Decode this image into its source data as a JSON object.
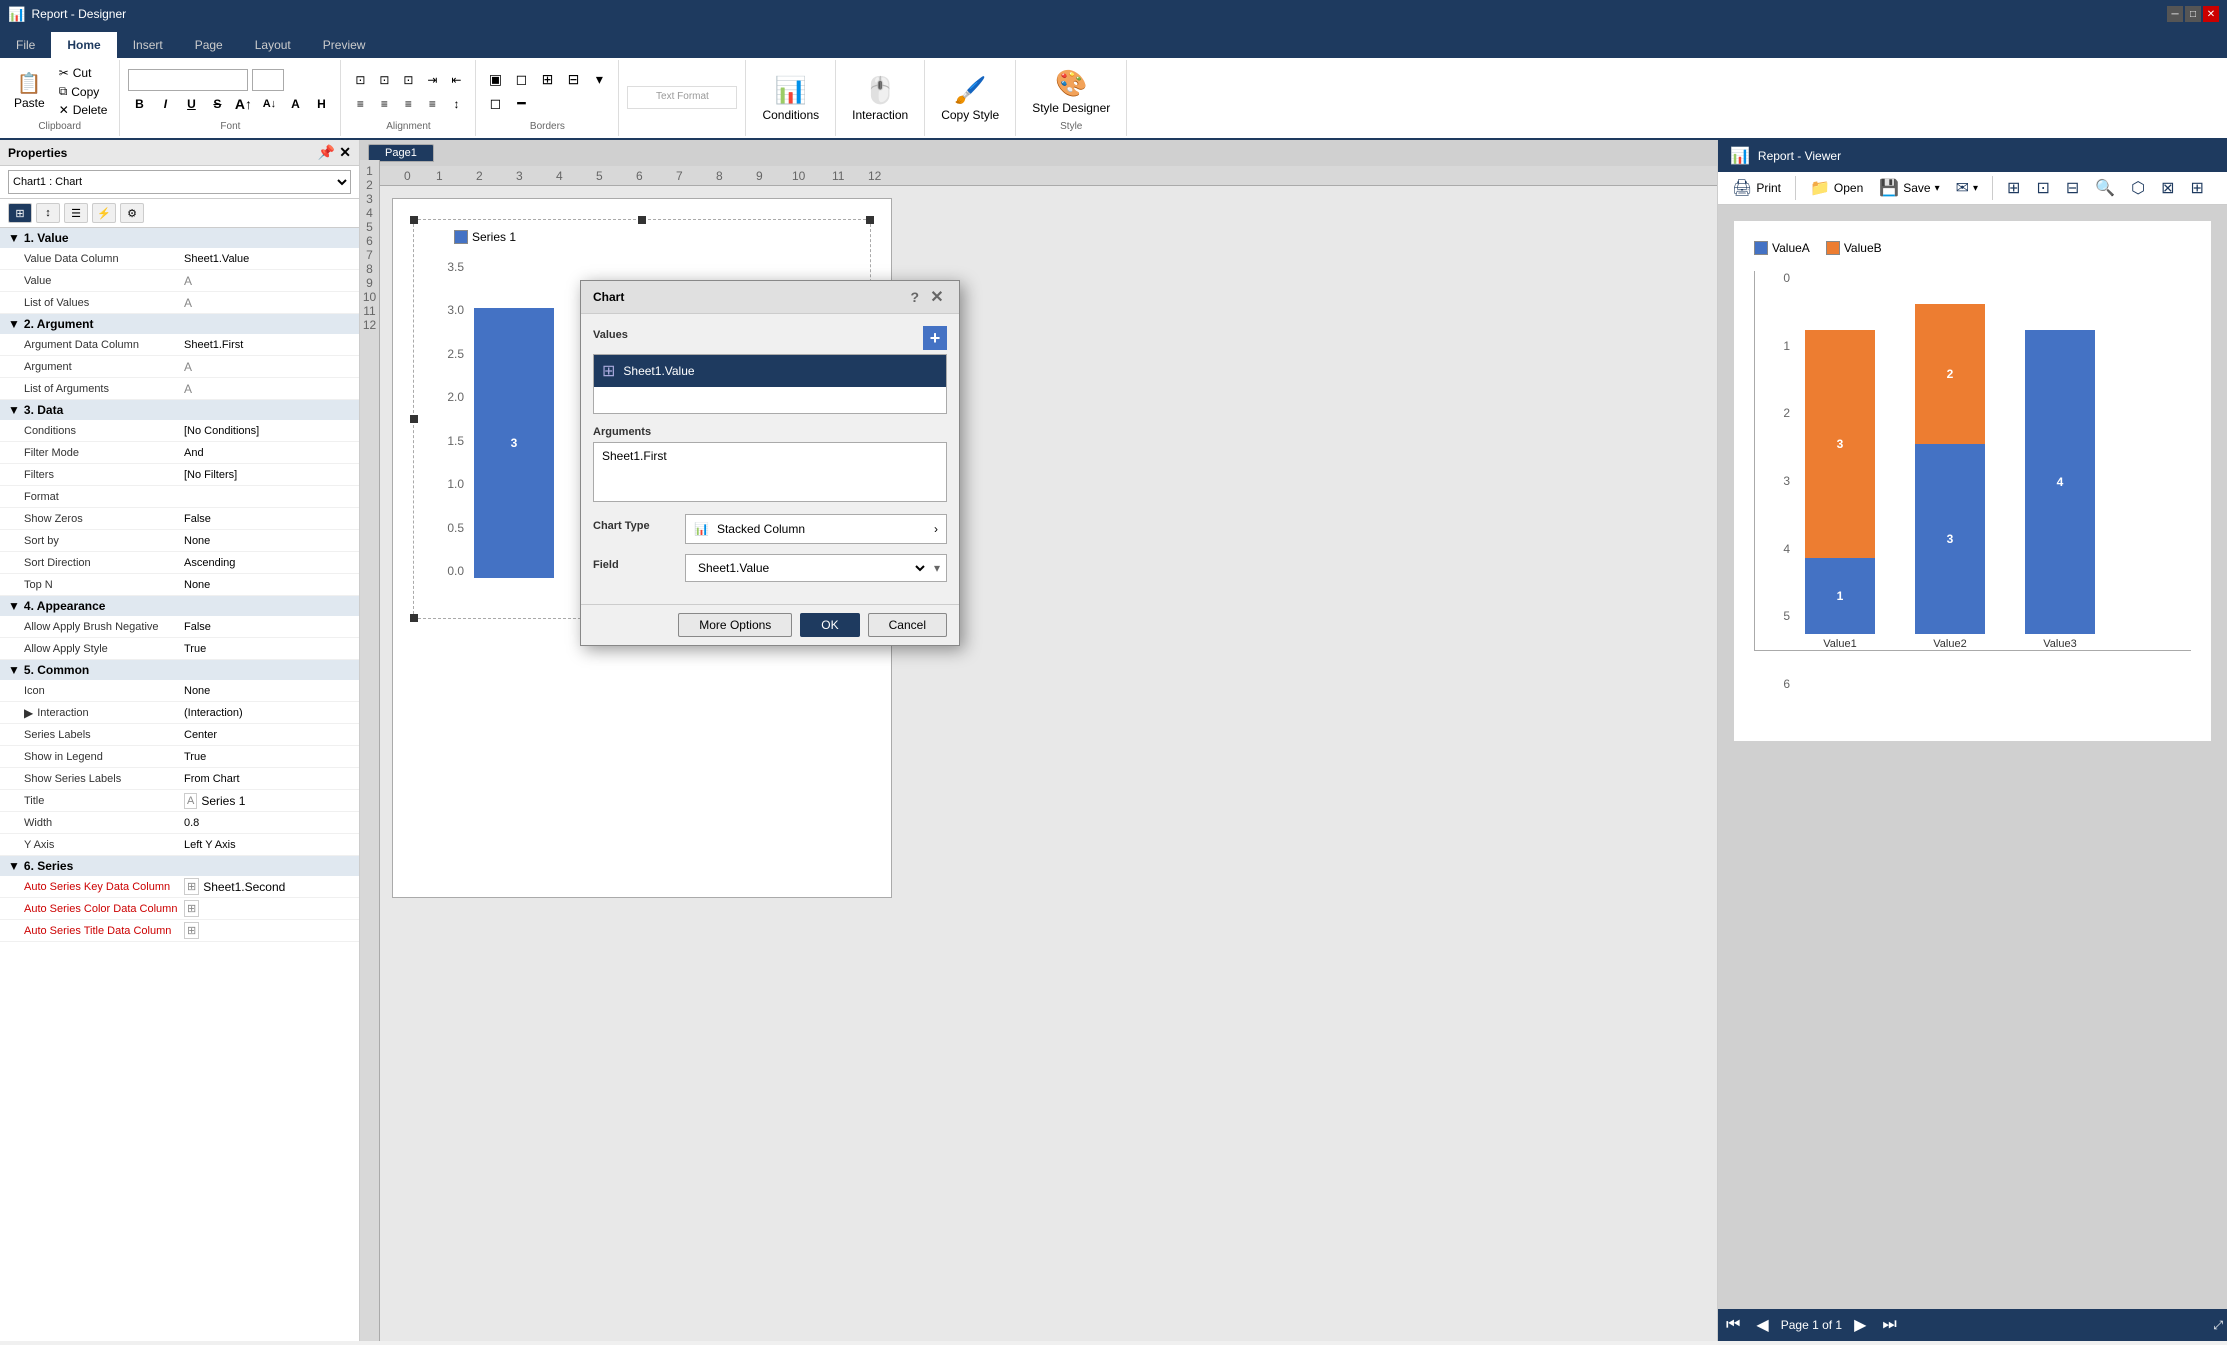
{
  "app": {
    "title": "Report - Designer",
    "viewer_title": "Report - Viewer"
  },
  "ribbon": {
    "tabs": [
      "File",
      "Home",
      "Insert",
      "Page",
      "Layout",
      "Preview"
    ],
    "active_tab": "Home",
    "groups": {
      "clipboard": {
        "label": "Clipboard",
        "buttons": [
          "Cut",
          "Copy",
          "Delete"
        ]
      },
      "font": {
        "label": "Font",
        "font_name": "",
        "font_size": "",
        "bold": "B",
        "italic": "I",
        "underline": "U"
      },
      "alignment": {
        "label": "Alignment"
      },
      "borders": {
        "label": "Borders"
      },
      "text_format": {
        "label": "Text Format"
      },
      "conditions_label": "Conditions",
      "interaction_label": "Interaction",
      "copy_style_label": "Copy Style",
      "style_designer_label": "Style Designer"
    }
  },
  "properties": {
    "panel_title": "Properties",
    "chart_selector": "Chart1 : Chart",
    "sections": {
      "value": {
        "title": "1. Value",
        "rows": [
          {
            "label": "Value Data Column",
            "value": "Sheet1.Value",
            "red": false
          },
          {
            "label": "Value",
            "value": "",
            "red": false
          },
          {
            "label": "List of Values",
            "value": "",
            "red": false
          }
        ]
      },
      "argument": {
        "title": "2. Argument",
        "rows": [
          {
            "label": "Argument Data Column",
            "value": "Sheet1.First",
            "red": false
          },
          {
            "label": "Argument",
            "value": "",
            "red": false
          },
          {
            "label": "List of Arguments",
            "value": "",
            "red": false
          }
        ]
      },
      "data": {
        "title": "3. Data",
        "rows": [
          {
            "label": "Conditions",
            "value": "[No Conditions]",
            "red": false
          },
          {
            "label": "Filter Mode",
            "value": "And",
            "red": false
          },
          {
            "label": "Filters",
            "value": "[No Filters]",
            "red": false
          },
          {
            "label": "Format",
            "value": "",
            "red": false
          },
          {
            "label": "Show Zeros",
            "value": "False",
            "red": false
          },
          {
            "label": "Sort by",
            "value": "None",
            "red": false
          },
          {
            "label": "Sort Direction",
            "value": "Ascending",
            "red": false
          },
          {
            "label": "Top N",
            "value": "None",
            "red": false
          }
        ]
      },
      "appearance": {
        "title": "4. Appearance",
        "rows": [
          {
            "label": "Allow Apply Brush Negative",
            "value": "False",
            "red": false
          },
          {
            "label": "Allow Apply Style",
            "value": "True",
            "red": false
          }
        ]
      },
      "common": {
        "title": "5. Common",
        "rows": [
          {
            "label": "Icon",
            "value": "None",
            "red": false
          },
          {
            "label": "Interaction",
            "value": "(Interaction)",
            "red": false
          },
          {
            "label": "Series Labels",
            "value": "Center",
            "red": false
          },
          {
            "label": "Show in Legend",
            "value": "True",
            "red": false
          },
          {
            "label": "Show Series Labels",
            "value": "From Chart",
            "red": false
          },
          {
            "label": "Title",
            "value": "Series 1",
            "red": false
          },
          {
            "label": "Width",
            "value": "0.8",
            "red": false
          },
          {
            "label": "Y Axis",
            "value": "Left Y Axis",
            "red": false
          }
        ]
      },
      "series": {
        "title": "6. Series",
        "rows": [
          {
            "label": "Auto Series Key Data Column",
            "value": "Sheet1.Second",
            "red": true
          },
          {
            "label": "Auto Series Color Data Column",
            "value": "",
            "red": true
          },
          {
            "label": "Auto Series Title Data Column",
            "value": "",
            "red": true
          }
        ]
      }
    }
  },
  "page": {
    "tabs": [
      "Page1"
    ],
    "active_tab": "Page1"
  },
  "chart": {
    "legend_items": [
      "Series 1"
    ],
    "y_axis_labels": [
      "3.5",
      "3.0",
      "2.5",
      "2.0",
      "1.5",
      "1.0",
      "0.5",
      "0.0"
    ],
    "bars": [
      {
        "height_pct": 85,
        "label": "3"
      },
      {
        "height_pct": 55,
        "label": "2"
      }
    ]
  },
  "viewer": {
    "toolbar_buttons": [
      "Print",
      "Open",
      "Save",
      "Email"
    ],
    "legend_items": [
      {
        "color": "#4472c4",
        "label": "ValueA"
      },
      {
        "color": "#ed7d31",
        "label": "ValueB"
      }
    ],
    "y_axis_labels": [
      "6",
      "5",
      "4",
      "3",
      "2",
      "1",
      "0"
    ],
    "bars": [
      {
        "label": "Value1",
        "segments": [
          {
            "color": "#4472c4",
            "height_pct": 20,
            "label": "1"
          },
          {
            "color": "#ed7d31",
            "height_pct": 60,
            "label": "3"
          }
        ]
      },
      {
        "label": "Value2",
        "segments": [
          {
            "color": "#4472c4",
            "height_pct": 50,
            "label": "3"
          },
          {
            "color": "#ed7d31",
            "height_pct": 37,
            "label": "2"
          }
        ]
      },
      {
        "label": "Value3",
        "segments": [
          {
            "color": "#4472c4",
            "height_pct": 67,
            "label": "4"
          },
          {
            "color": "#ed7d31",
            "height_pct": 0,
            "label": ""
          }
        ]
      }
    ],
    "page_info": "Page 1 of 1"
  },
  "modal": {
    "title": "Chart",
    "values_label": "Values",
    "values_item": "Sheet1.Value",
    "arguments_label": "Arguments",
    "arguments_item": "Sheet1.First",
    "chart_type_label": "Chart Type",
    "chart_type_value": "Stacked Column",
    "field_label": "Field",
    "field_value": "Sheet1.Value",
    "more_options_label": "More Options",
    "ok_label": "OK",
    "cancel_label": "Cancel"
  }
}
